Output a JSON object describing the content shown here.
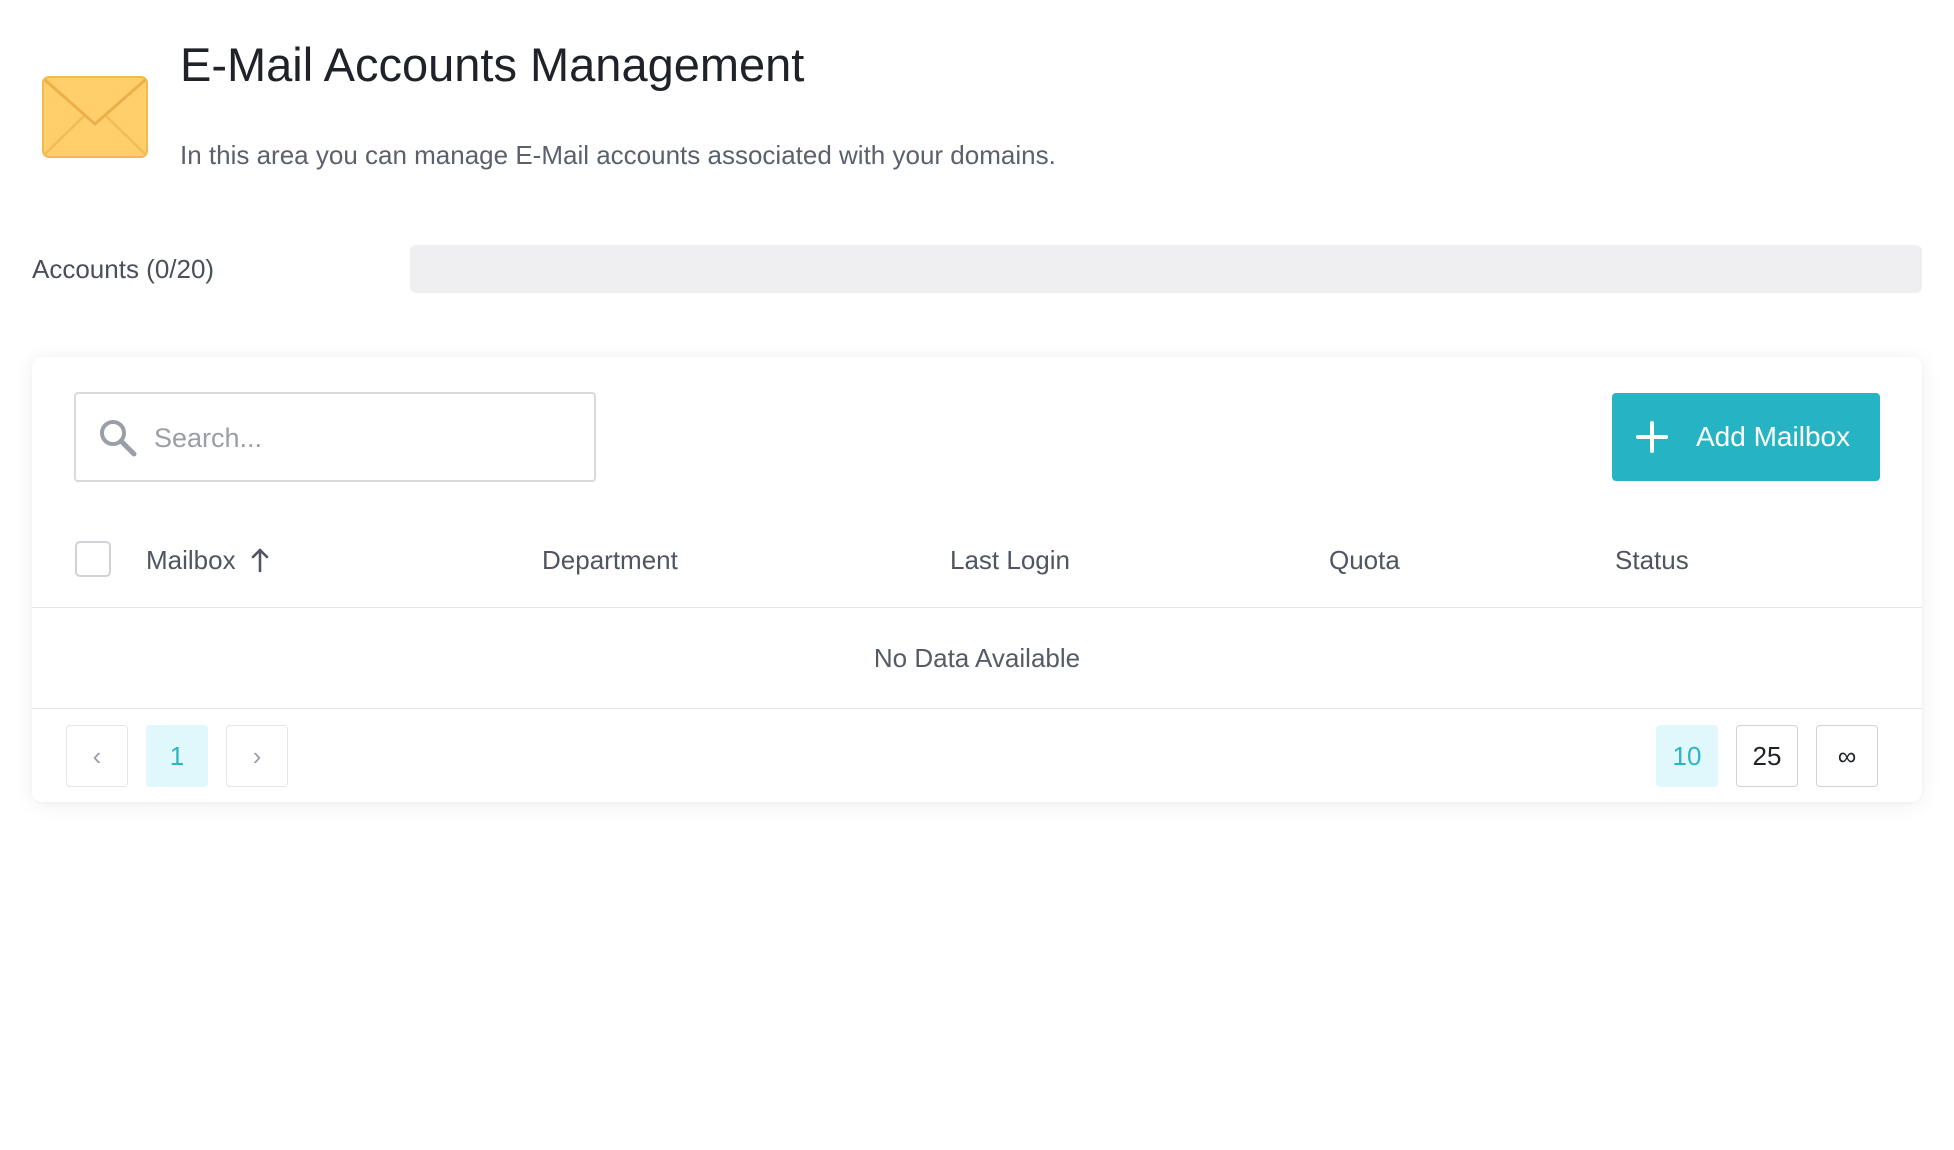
{
  "header": {
    "title": "E-Mail Accounts Management",
    "subtitle": "In this area you can manage E-Mail accounts associated with your domains.",
    "icon": "envelope-icon"
  },
  "usage": {
    "label": "Accounts (0/20)",
    "used": 0,
    "limit": 20,
    "fill_fraction": 0
  },
  "toolbar": {
    "search_placeholder": "Search...",
    "search_value": "",
    "add_label": "Add Mailbox"
  },
  "table": {
    "columns": [
      "Mailbox",
      "Department",
      "Last Login",
      "Quota",
      "Status"
    ],
    "sort_column": "Mailbox",
    "sort_direction": "ascending",
    "rows": [],
    "empty_message": "No Data Available"
  },
  "pagination": {
    "prev": "‹",
    "next": "›",
    "current_page": "1",
    "page_sizes": [
      "10",
      "25",
      "∞"
    ],
    "selected_page_size": "10"
  },
  "colors": {
    "accent": "#26b4c4",
    "envelope": "#ffc95e",
    "active_bg": "#e0f8fb"
  }
}
